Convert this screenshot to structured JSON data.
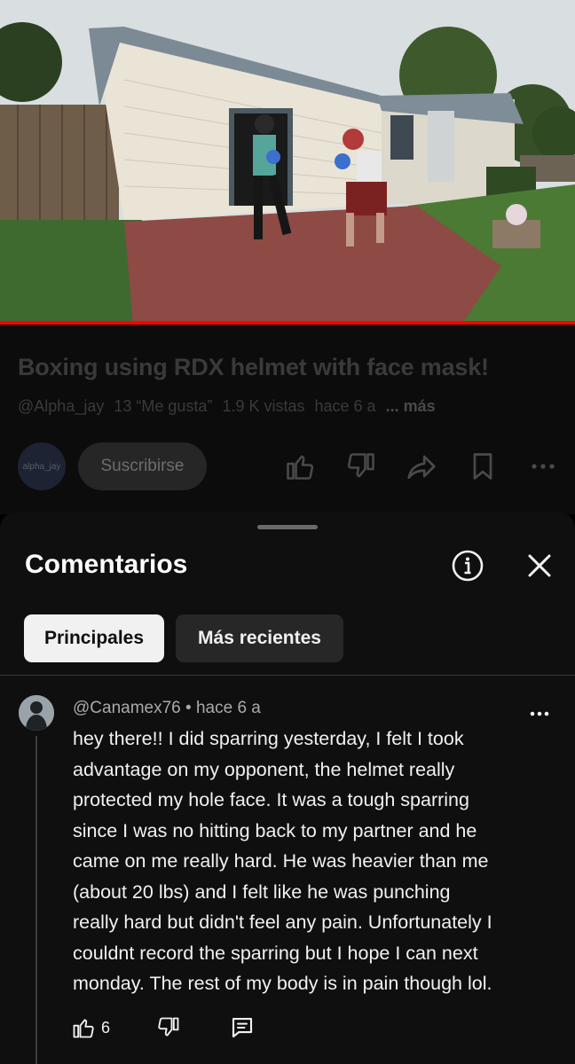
{
  "video": {
    "progress_fraction": 1.0,
    "title": "Boxing using RDX helmet with face mask!",
    "channel_handle": "@Alpha_jay",
    "likes_text": "13 “Me gusta”",
    "views_text": "1.9 K vistas",
    "age_text": "hace 6 a",
    "more_label": "... más",
    "channel_avatar_text": "alpha_jay",
    "subscribe_label": "Suscribirse",
    "actions": [
      "like-icon",
      "dislike-icon",
      "share-icon",
      "save-icon",
      "more-icon"
    ]
  },
  "comments_sheet": {
    "title": "Comentarios",
    "icons": [
      "info-icon",
      "close-icon"
    ],
    "filters": [
      {
        "label": "Principales",
        "selected": true
      },
      {
        "label": "Más recientes",
        "selected": false
      }
    ],
    "comment": {
      "author": "@Canamex76",
      "separator": "•",
      "age": "hace 6 a",
      "text": "hey there!! I did sparring yesterday, I felt I took\nadvantage on my opponent, the helmet really\nprotected my hole face. It was a tough sparring\nsince I was no hitting back to my partner and he\ncame on me really hard. He was heavier than me\n(about 20 lbs) and I felt like he was punching\nreally hard but didn't feel any pain. Unfortunately I\ncouldnt record the sparring but I hope I can next\nmonday. The rest of my body is in pain though lol.",
      "like_count": "6",
      "icons": [
        "like-icon",
        "dislike-icon",
        "reply-icon",
        "more-vert-icon"
      ]
    }
  },
  "colors": {
    "progress": "#ff0000",
    "sheet_bg": "#0f0f0f",
    "chip_active": "#f1f1f1",
    "chip_idle": "#272727"
  }
}
